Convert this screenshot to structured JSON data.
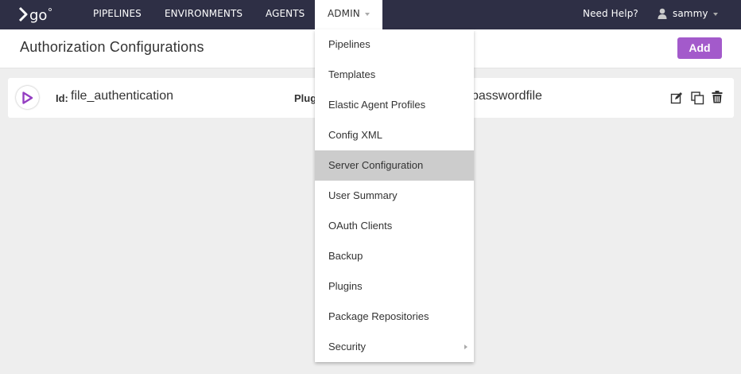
{
  "nav": {
    "items": [
      "PIPELINES",
      "ENVIRONMENTS",
      "AGENTS",
      "ADMIN"
    ],
    "help": "Need Help?",
    "user": "sammy"
  },
  "header": {
    "title": "Authorization Configurations",
    "add_label": "Add"
  },
  "config": {
    "id_label": "Id:",
    "id_value": "file_authentication",
    "plugin_label": "Plug",
    "plugin_value": "passwordfile"
  },
  "admin_menu": {
    "items": [
      "Pipelines",
      "Templates",
      "Elastic Agent Profiles",
      "Config XML",
      "Server Configuration",
      "User Summary",
      "OAuth Clients",
      "Backup",
      "Plugins",
      "Package Repositories",
      "Security"
    ],
    "active": "Server Configuration"
  },
  "colors": {
    "nav_bg": "#2e2f45",
    "accent": "#943ec2",
    "active_item": "#cccccc"
  }
}
